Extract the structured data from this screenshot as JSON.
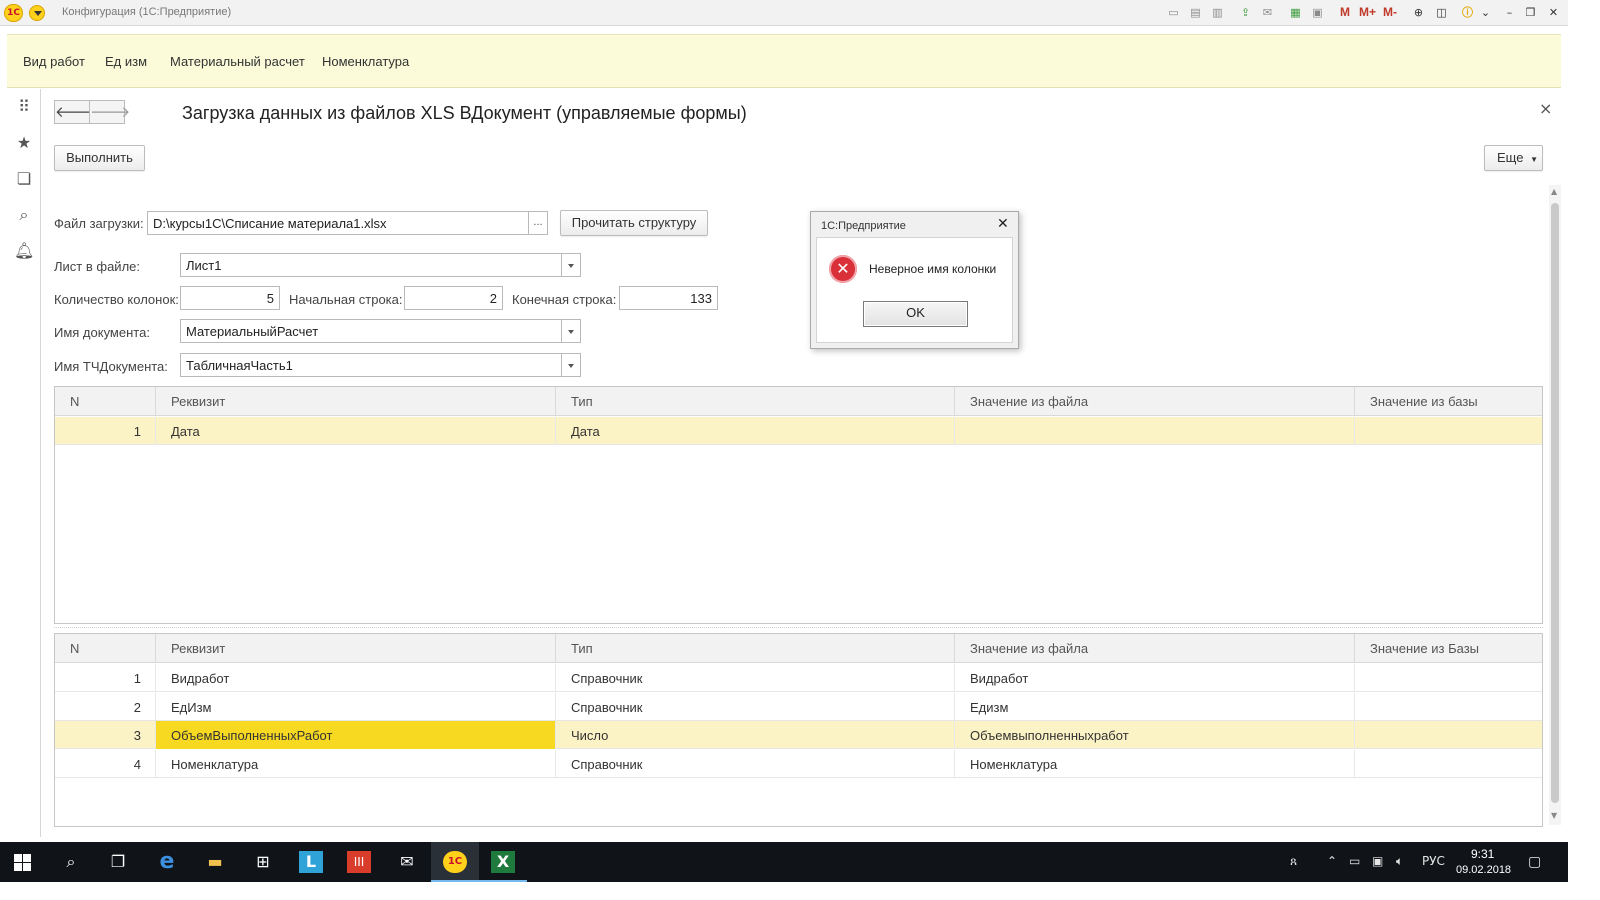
{
  "window": {
    "title": "Конфигурация (1С:Предприятие)",
    "logo_text": "1С",
    "toolbar_m_labels": [
      "M",
      "M+",
      "M-"
    ]
  },
  "sections": [
    "Вид работ",
    "Ед изм",
    "Материальный расчет",
    "Номенклатура"
  ],
  "left_bar": [
    "apps-grid-icon",
    "star-icon",
    "history-icon",
    "search-icon",
    "bell-icon"
  ],
  "form": {
    "title": "Загрузка данных из файлов XLS ВДокумент (управляемые формы)",
    "close_glyph": "×",
    "nav_back": "🡐",
    "nav_forward": "🡒",
    "execute_button": "Выполнить",
    "more_button": "Еще",
    "file_label": "Файл загрузки:",
    "file_value": "D:\\курсы1С\\Списание материала1.xlsx",
    "file_select_button": "...",
    "read_structure_button": "Прочитать структуру",
    "sheet_label": "Лист в файле:",
    "sheet_value": "Лист1",
    "columns_label": "Количество колонок:",
    "columns_value": "5",
    "start_row_label": "Начальная строка:",
    "start_row_value": "2",
    "end_row_label": "Конечная строка:",
    "end_row_value": "133",
    "doc_name_label": "Имя документа:",
    "doc_name_value": "МатериальныйРасчет",
    "tab_name_label": "Имя ТЧДокумента:",
    "tab_name_value": "ТабличнаяЧасть1"
  },
  "header_table": {
    "columns": [
      "N",
      "Реквизит",
      "Тип",
      "Значение из файла",
      "Значение из базы"
    ],
    "rows": [
      {
        "n": "1",
        "attr": "Дата",
        "type": "Дата",
        "file_value": "",
        "db_value": ""
      }
    ]
  },
  "tabular_table": {
    "columns": [
      "N",
      "Реквизит",
      "Тип",
      "Значение из файла",
      "Значение из Базы"
    ],
    "rows": [
      {
        "n": "1",
        "attr": "Видработ",
        "type": "Справочник",
        "file_value": "Видработ",
        "db_value": ""
      },
      {
        "n": "2",
        "attr": "ЕдИзм",
        "type": "Справочник",
        "file_value": "Едизм",
        "db_value": ""
      },
      {
        "n": "3",
        "attr": "ОбъемВыполненныхРабот",
        "type": "Число",
        "file_value": "Объемвыполненныхработ",
        "db_value": ""
      },
      {
        "n": "4",
        "attr": "Номенклатура",
        "type": "Справочник",
        "file_value": "Номенклатура",
        "db_value": ""
      }
    ]
  },
  "dialog": {
    "title": "1С:Предприятие",
    "message": "Неверное имя колонки",
    "ok_button": "OK",
    "close_glyph": "✕",
    "icon": "error-icon"
  },
  "taskbar": {
    "apps": [
      "start-icon",
      "search-icon",
      "task-view-icon",
      "edge-icon",
      "explorer-icon",
      "store-icon",
      "l-app-icon",
      "red-app-icon",
      "mail-icon",
      "1c-icon",
      "excel-icon"
    ],
    "language": "РУС",
    "time": "9:31",
    "date": "09.02.2018"
  },
  "colors": {
    "section_panel": "#fbfbda",
    "selected_row": "#fbf3c5",
    "current_cell": "#f8d922",
    "error_icon": "#d9303a",
    "taskbar": "#101419"
  }
}
